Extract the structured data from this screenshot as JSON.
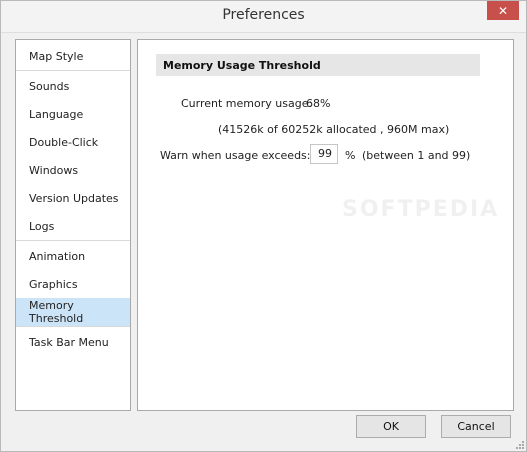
{
  "window": {
    "title": "Preferences",
    "close_icon": "close-icon"
  },
  "sidebar": {
    "items": [
      {
        "label": "Map Style"
      },
      {
        "label": "Sounds"
      },
      {
        "label": "Language"
      },
      {
        "label": "Double-Click"
      },
      {
        "label": "Windows"
      },
      {
        "label": "Version Updates"
      },
      {
        "label": "Logs"
      },
      {
        "label": "Animation"
      },
      {
        "label": "Graphics"
      },
      {
        "label": "Memory Threshold"
      },
      {
        "label": "Task Bar Menu"
      }
    ],
    "selected": "Memory Threshold",
    "selected_color": "#cce4f7"
  },
  "panel": {
    "header": "Memory Usage Threshold",
    "current_label": "Current memory usage:",
    "current_value": "68%",
    "details": "(41526k of 60252k allocated , 960M max)",
    "warn_label": "Warn when usage exceeds:",
    "warn_value": "99",
    "percent_symbol": "%",
    "range_note": "(between 1 and 99)"
  },
  "watermark": "SOFTPEDIA",
  "buttons": {
    "ok_label": "OK",
    "cancel_label": "Cancel"
  }
}
